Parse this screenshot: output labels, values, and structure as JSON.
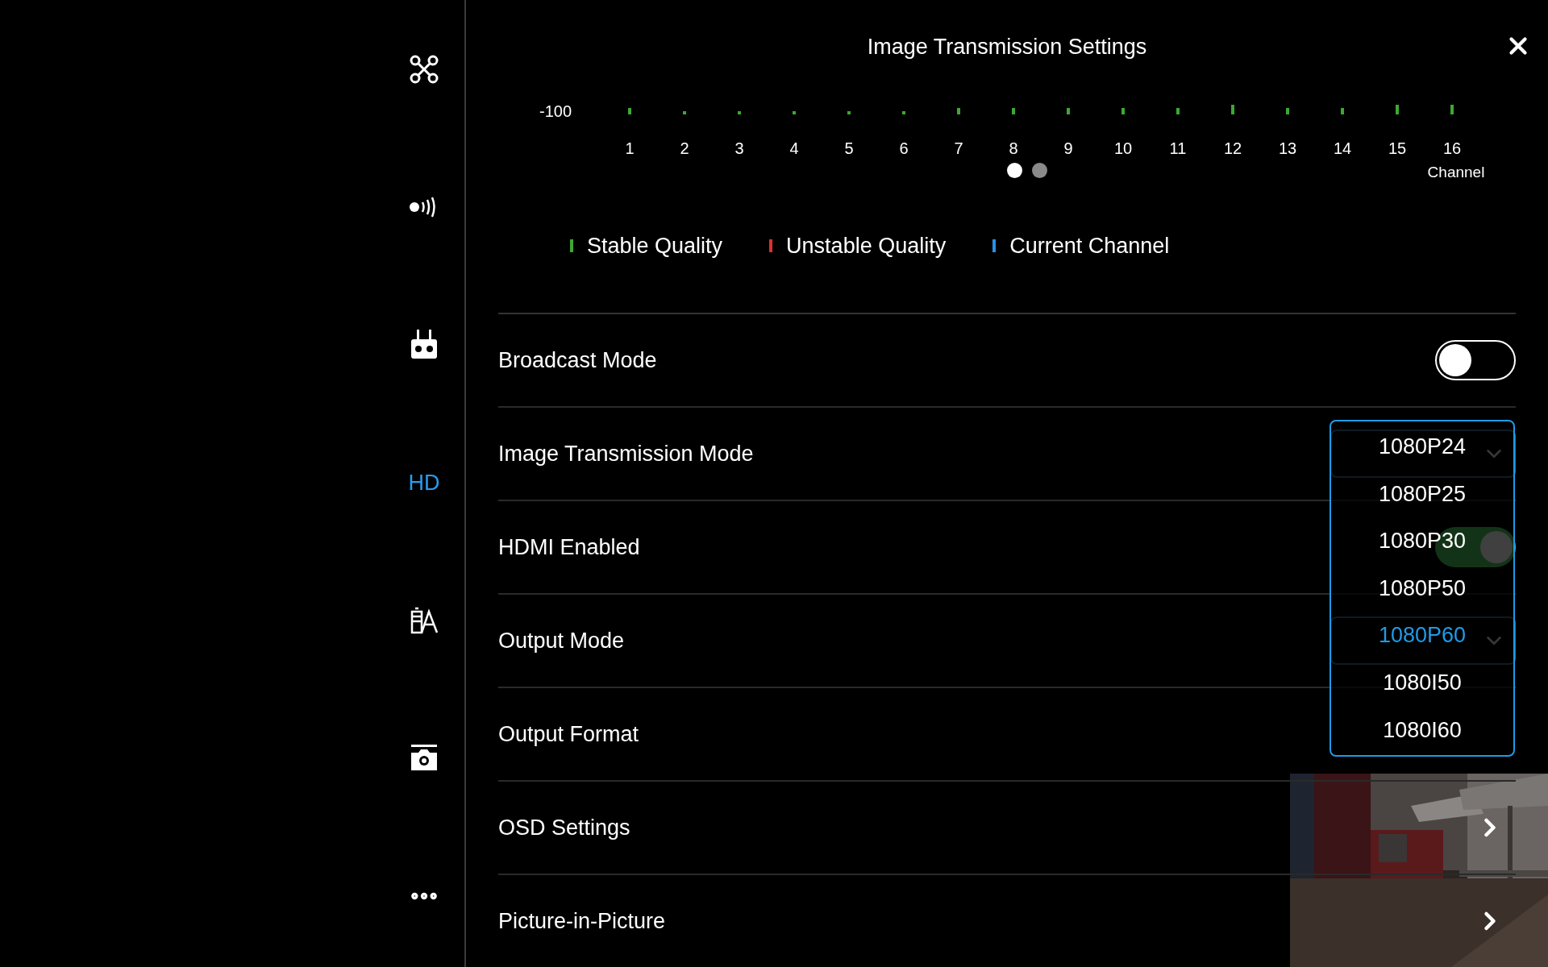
{
  "sidebar": {
    "items": [
      {
        "kind": "drone",
        "selected": false
      },
      {
        "kind": "signal",
        "selected": false
      },
      {
        "kind": "remote",
        "selected": false
      },
      {
        "kind": "text",
        "label": "HD",
        "selected": true
      },
      {
        "kind": "battery",
        "selected": false
      },
      {
        "kind": "camera",
        "selected": false
      },
      {
        "kind": "more",
        "selected": false
      }
    ]
  },
  "title": "Image Transmission Settings",
  "channel_chart": {
    "axis_label": "-100",
    "x_label": "Channel",
    "channels": [
      "1",
      "2",
      "3",
      "4",
      "5",
      "6",
      "7",
      "8",
      "9",
      "10",
      "11",
      "12",
      "13",
      "14",
      "15",
      "16"
    ],
    "pages": [
      {
        "selected": true
      },
      {
        "selected": false
      }
    ]
  },
  "legend": [
    {
      "label": "Stable Quality",
      "color": "#3da832"
    },
    {
      "label": "Unstable Quality",
      "color": "#e0302a"
    },
    {
      "label": "Current Channel",
      "color": "#2a8fe8"
    }
  ],
  "rows": [
    {
      "kind": "toggle",
      "label": "Broadcast Mode",
      "on": false
    },
    {
      "kind": "select",
      "label": "Image Transmission Mode"
    },
    {
      "kind": "toggle",
      "label": "HDMI Enabled",
      "on": true
    },
    {
      "kind": "select",
      "label": "Output Mode"
    },
    {
      "kind": "plain",
      "label": "Output Format"
    },
    {
      "kind": "link",
      "label": "OSD Settings"
    },
    {
      "kind": "link",
      "label": "Picture-in-Picture"
    }
  ],
  "dropdown": {
    "options": [
      {
        "label": "1080P24",
        "selected": false
      },
      {
        "label": "1080P25",
        "selected": false
      },
      {
        "label": "1080P30",
        "selected": false
      },
      {
        "label": "1080P50",
        "selected": false
      },
      {
        "label": "1080P60",
        "selected": true
      },
      {
        "label": "1080I50",
        "selected": false
      },
      {
        "label": "1080I60",
        "selected": false
      }
    ]
  }
}
